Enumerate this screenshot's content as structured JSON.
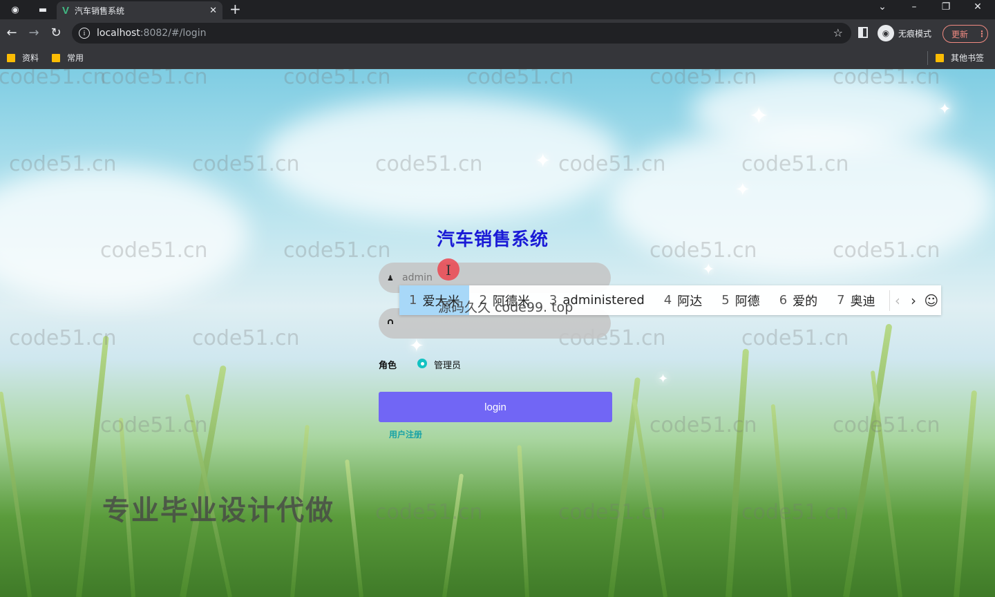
{
  "browser": {
    "tab_title": "汽车销售系统",
    "url_host": "localhost",
    "url_path": ":8082/#/login",
    "incognito_label": "无痕模式",
    "update_label": "更新",
    "bookmarks": [
      "资料",
      "常用"
    ],
    "other_bookmarks": "其他书签"
  },
  "login": {
    "system_title": "汽车销售系统",
    "username_value": "admin",
    "password_value": "",
    "role_label": "角色",
    "role_option": "管理员",
    "login_button": "login",
    "register_link": "用户注册"
  },
  "ime": {
    "candidates": [
      {
        "num": "1",
        "text": "爱大米"
      },
      {
        "num": "2",
        "text": "阿德米"
      },
      {
        "num": "3",
        "text": "administered"
      },
      {
        "num": "4",
        "text": "阿达"
      },
      {
        "num": "5",
        "text": "阿德"
      },
      {
        "num": "6",
        "text": "爱的"
      },
      {
        "num": "7",
        "text": "奥迪"
      }
    ]
  },
  "overlays": {
    "watermark": "code51.cn",
    "source_text": "源码久久 code99. top",
    "promo_text": "专业毕业设计代做"
  }
}
